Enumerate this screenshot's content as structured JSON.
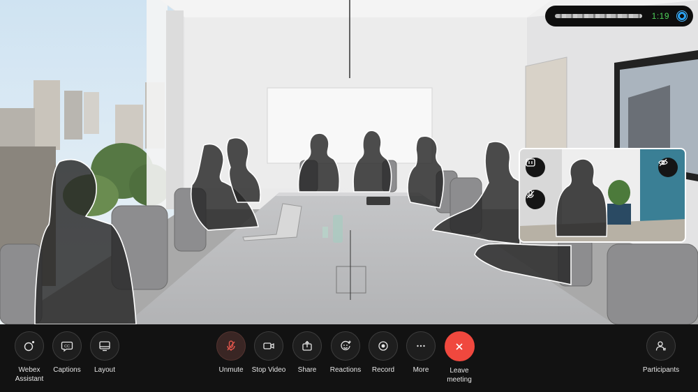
{
  "status_bar": {
    "meeting_timer": "1:19",
    "status_icon": "webex-status-icon"
  },
  "self_view": {
    "layout_button_icon": "layout-switch-icon",
    "mute_button_icon": "mic-off-icon",
    "hide_button_icon": "eye-off-icon"
  },
  "toolbar": {
    "left": [
      {
        "id": "webex-assistant",
        "label": "Webex\nAssistant",
        "icon": "assistant-icon"
      },
      {
        "id": "captions",
        "label": "Captions",
        "icon": "captions-icon"
      },
      {
        "id": "layout",
        "label": "Layout",
        "icon": "layout-icon"
      }
    ],
    "center": [
      {
        "id": "unmute",
        "label": "Unmute",
        "icon": "mic-off-icon"
      },
      {
        "id": "stop-video",
        "label": "Stop Video",
        "icon": "camera-icon"
      },
      {
        "id": "share",
        "label": "Share",
        "icon": "share-icon"
      },
      {
        "id": "reactions",
        "label": "Reactions",
        "icon": "reactions-icon"
      },
      {
        "id": "record",
        "label": "Record",
        "icon": "record-icon"
      },
      {
        "id": "more",
        "label": "More",
        "icon": "more-icon"
      },
      {
        "id": "leave-meeting",
        "label": "Leave\nmeeting",
        "icon": "close-icon"
      }
    ],
    "right": [
      {
        "id": "participants",
        "label": "Participants",
        "icon": "participants-icon"
      }
    ]
  },
  "colors": {
    "toolbar_bg": "#121212",
    "leave_red": "#f0483e",
    "timer_green": "#4fd25a",
    "muted_icon": "#e0554b"
  }
}
